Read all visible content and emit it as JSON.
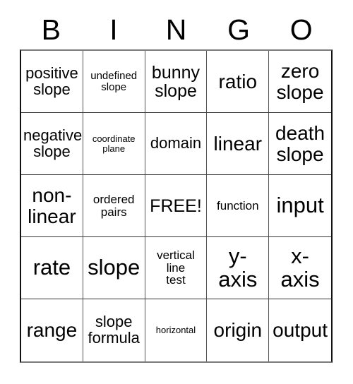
{
  "card": {
    "title_letters": [
      "B",
      "I",
      "N",
      "G",
      "O"
    ],
    "rows": [
      [
        {
          "text": "positive\nslope",
          "size": "md"
        },
        {
          "text": "undefined\nslope",
          "size": "xs"
        },
        {
          "text": "bunny\nslope",
          "size": "lg"
        },
        {
          "text": "ratio",
          "size": "xl"
        },
        {
          "text": "zero\nslope",
          "size": "xl"
        }
      ],
      [
        {
          "text": "negative\nslope",
          "size": "md"
        },
        {
          "text": "coordinate\nplane",
          "size": "xxs"
        },
        {
          "text": "domain",
          "size": "md"
        },
        {
          "text": "linear",
          "size": "xl"
        },
        {
          "text": "death\nslope",
          "size": "xl"
        }
      ],
      [
        {
          "text": "non-\nlinear",
          "size": "xl"
        },
        {
          "text": "ordered\npairs",
          "size": "sm"
        },
        {
          "text": "FREE!",
          "size": "lg"
        },
        {
          "text": "function",
          "size": "sm"
        },
        {
          "text": "input",
          "size": "xxl"
        }
      ],
      [
        {
          "text": "rate",
          "size": "xxl"
        },
        {
          "text": "slope",
          "size": "xxl"
        },
        {
          "text": "vertical\nline\ntest",
          "size": "sm"
        },
        {
          "text": "y-\naxis",
          "size": "xxl"
        },
        {
          "text": "x-\naxis",
          "size": "xxl"
        }
      ],
      [
        {
          "text": "range",
          "size": "xl"
        },
        {
          "text": "slope\nformula",
          "size": "md"
        },
        {
          "text": "horizontal",
          "size": "xxs"
        },
        {
          "text": "origin",
          "size": "xl"
        },
        {
          "text": "output",
          "size": "xl"
        }
      ]
    ]
  },
  "colors": {
    "background": "#ffffff",
    "text": "#000000",
    "grid_line": "#333333",
    "grid_border": "#111111"
  }
}
